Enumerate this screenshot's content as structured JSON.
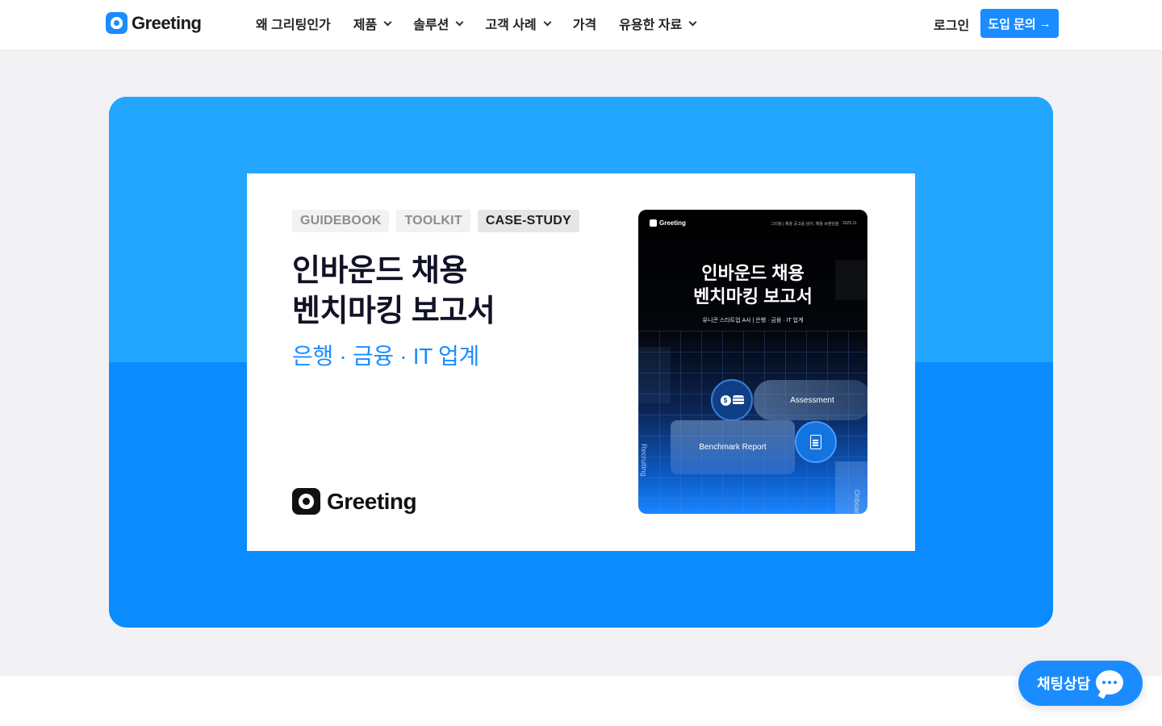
{
  "header": {
    "logo_text": "Greeting",
    "nav": [
      {
        "label": "왜 그리팅인가",
        "dropdown": false
      },
      {
        "label": "제품",
        "dropdown": true
      },
      {
        "label": "솔루션",
        "dropdown": true
      },
      {
        "label": "고객 사례",
        "dropdown": true
      },
      {
        "label": "가격",
        "dropdown": false
      },
      {
        "label": "유용한 자료",
        "dropdown": true
      }
    ],
    "login_label": "로그인",
    "cta_label": "도입 문의",
    "cta_arrow": "→"
  },
  "card": {
    "tags": [
      {
        "label": "GUIDEBOOK",
        "active": false
      },
      {
        "label": "TOOLKIT",
        "active": false
      },
      {
        "label": "CASE-STUDY",
        "active": true
      }
    ],
    "title": "인바운드 채용\n벤치마킹 보고서",
    "subtitle": "은행 · 금융 · IT 업계",
    "logo_text": "Greeting"
  },
  "cover": {
    "logo_text": "Greeting",
    "meta_text": "그리팅 | 채용 공고를 넘어, 채용 브랜딩을",
    "date_text": "2025.11",
    "title": "인바운드 채용\n벤치마킹 보고서",
    "subtitle": "유니콘 스타트업 A사 | 은행 · 금융 · IT 업계",
    "pill_assessment": "Assessment",
    "pill_benchmark": "Benchmark Report",
    "side_text": "Recruiting",
    "side_text2": "Onboard",
    "coin_symbol": "$"
  },
  "chat": {
    "label": "채팅상담"
  },
  "colors": {
    "brand": "#1a8cff",
    "hero_top": "#23a6ff",
    "hero_bottom": "#0a8cff",
    "section_bg": "#f2f2f4"
  }
}
